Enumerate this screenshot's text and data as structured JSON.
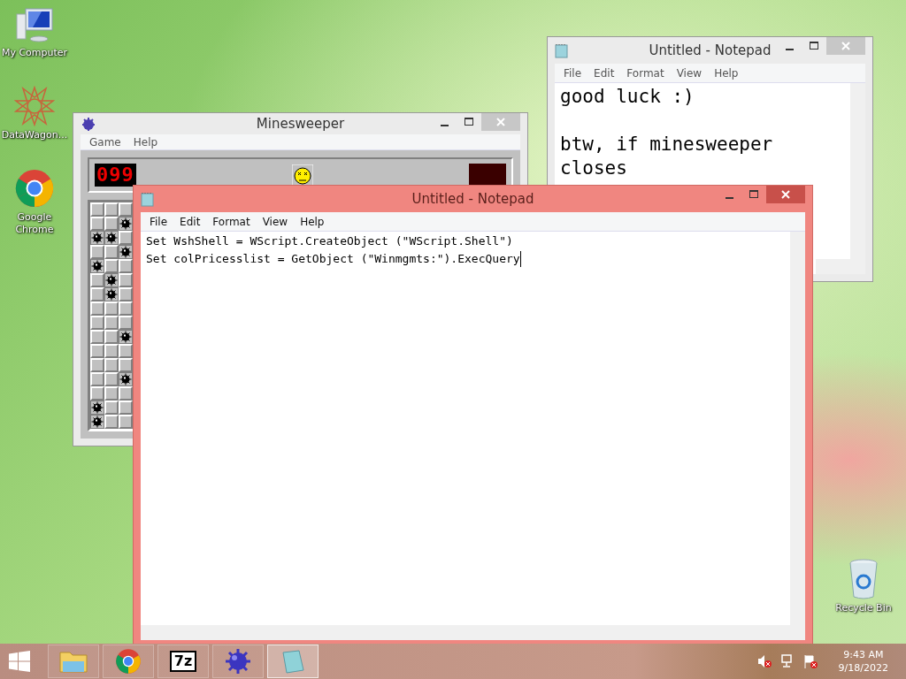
{
  "desktop_icons": [
    {
      "kind": "computer",
      "label": "My Computer"
    },
    {
      "kind": "datawagon",
      "label": "DataWagon..."
    },
    {
      "kind": "chrome",
      "label": "Google Chrome"
    }
  ],
  "recycle_bin": {
    "label": "Recycle Bin"
  },
  "minesweeper": {
    "title": "Minesweeper",
    "active": false,
    "menu": [
      "Game",
      "Help"
    ],
    "mine_counter": "099",
    "board": {
      "rows": [
        [
          {
            "mine": false
          },
          {
            "mine": false
          },
          {
            "mine": false
          }
        ],
        [
          {
            "mine": false
          },
          {
            "mine": false
          },
          {
            "mine": true
          }
        ],
        [
          {
            "mine": true
          },
          {
            "mine": true
          },
          {
            "mine": false
          }
        ],
        [
          {
            "mine": false
          },
          {
            "mine": false
          },
          {
            "mine": true
          }
        ],
        [
          {
            "mine": true
          },
          {
            "mine": false
          },
          {
            "mine": false
          }
        ],
        [
          {
            "mine": false
          },
          {
            "mine": true
          },
          {
            "mine": false
          }
        ],
        [
          {
            "mine": false
          },
          {
            "mine": true
          },
          {
            "mine": false
          }
        ],
        [
          {
            "mine": false
          },
          {
            "mine": false
          },
          {
            "mine": false
          }
        ],
        [
          {
            "mine": false
          },
          {
            "mine": false
          },
          {
            "mine": false
          }
        ],
        [
          {
            "mine": false
          },
          {
            "mine": false
          },
          {
            "mine": true
          }
        ],
        [
          {
            "mine": false
          },
          {
            "mine": false
          },
          {
            "mine": false
          }
        ],
        [
          {
            "mine": false
          },
          {
            "mine": false
          },
          {
            "mine": false
          }
        ],
        [
          {
            "mine": false
          },
          {
            "mine": false
          },
          {
            "mine": true
          }
        ],
        [
          {
            "mine": false
          },
          {
            "mine": false
          },
          {
            "mine": false
          }
        ],
        [
          {
            "mine": true
          },
          {
            "mine": false
          },
          {
            "mine": false
          }
        ],
        [
          {
            "mine": true
          },
          {
            "mine": false
          },
          {
            "mine": false
          }
        ]
      ]
    }
  },
  "notepad_back": {
    "title": "Untitled - Notepad",
    "active": false,
    "menu": [
      "File",
      "Edit",
      "Format",
      "View",
      "Help"
    ],
    "text": "good luck :)\n\nbtw, if minesweeper\ncloses"
  },
  "notepad_front": {
    "title": "Untitled - Notepad",
    "active": true,
    "menu": [
      "File",
      "Edit",
      "Format",
      "View",
      "Help"
    ],
    "lines": [
      "Set WshShell = WScript.CreateObject (\"WScript.Shell\")",
      "Set colPricesslist = GetObject (\"Winmgmts:\").ExecQuery"
    ]
  },
  "taskbar": {
    "items": [
      {
        "kind": "explorer",
        "selected": false
      },
      {
        "kind": "chrome",
        "selected": false
      },
      {
        "kind": "sevenzip",
        "label": "7z",
        "selected": false
      },
      {
        "kind": "minesweeper",
        "selected": false
      },
      {
        "kind": "notepad",
        "selected": true
      }
    ],
    "time": "9:43 AM",
    "date": "9/18/2022"
  }
}
